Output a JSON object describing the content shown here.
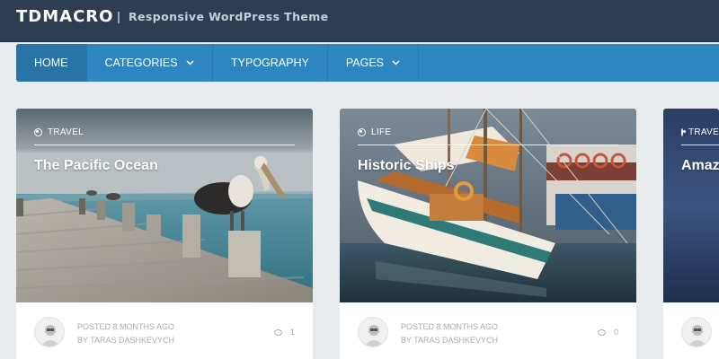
{
  "header": {
    "site_title": "TDMACRO",
    "separator": "|",
    "tagline": "Responsive WordPress Theme"
  },
  "nav": {
    "items": [
      {
        "label": "HOME",
        "active": true,
        "has_dropdown": false
      },
      {
        "label": "CATEGORIES",
        "active": false,
        "has_dropdown": true
      },
      {
        "label": "TYPOGRAPHY",
        "active": false,
        "has_dropdown": false
      },
      {
        "label": "PAGES",
        "active": false,
        "has_dropdown": true
      }
    ],
    "dropdown_icon": "chevron-down-icon"
  },
  "posts": [
    {
      "category": "TRAVEL",
      "title": "The Pacific Ocean",
      "posted": "POSTED 8 MONTHS AGO",
      "author": "BY TARAS DASHKEVYCH",
      "comments": "1",
      "category_icon": "target-icon"
    },
    {
      "category": "LIFE",
      "title": "Historic Ships",
      "posted": "POSTED 8 MONTHS AGO",
      "author": "BY TARAS DASHKEVYCH",
      "comments": "0",
      "category_icon": "target-icon"
    },
    {
      "category": "TRAVEL",
      "title": "Amaz",
      "posted": "",
      "author": "",
      "comments": "",
      "category_icon": "target-icon"
    }
  ],
  "colors": {
    "header_bg": "#2c3e50",
    "nav_bg": "#2e86c1",
    "nav_active_bg": "#2874a6",
    "page_bg": "#e9ecee",
    "meta_text": "#a7adb3"
  }
}
